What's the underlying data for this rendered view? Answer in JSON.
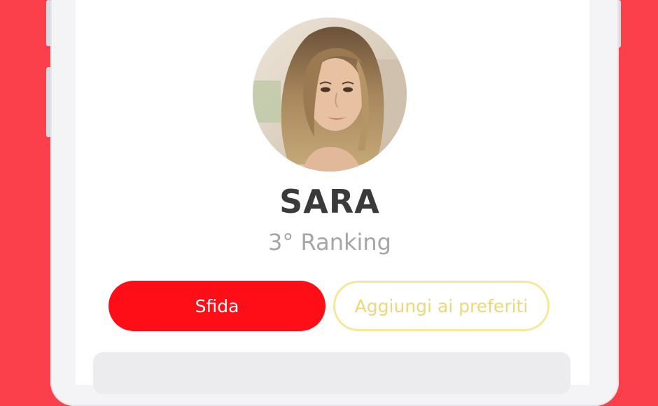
{
  "profile": {
    "name": "SARA",
    "ranking": "3° Ranking"
  },
  "actions": {
    "challenge_label": "Sfida",
    "favorite_label": "Aggiungi ai preferiti"
  },
  "colors": {
    "background": "#fb3f4b",
    "primary": "#ff0e17",
    "favorite_border": "#f3e99a",
    "favorite_text": "#ecd879",
    "name_text": "#3a3a3a",
    "ranking_text": "#a5a5a5"
  }
}
